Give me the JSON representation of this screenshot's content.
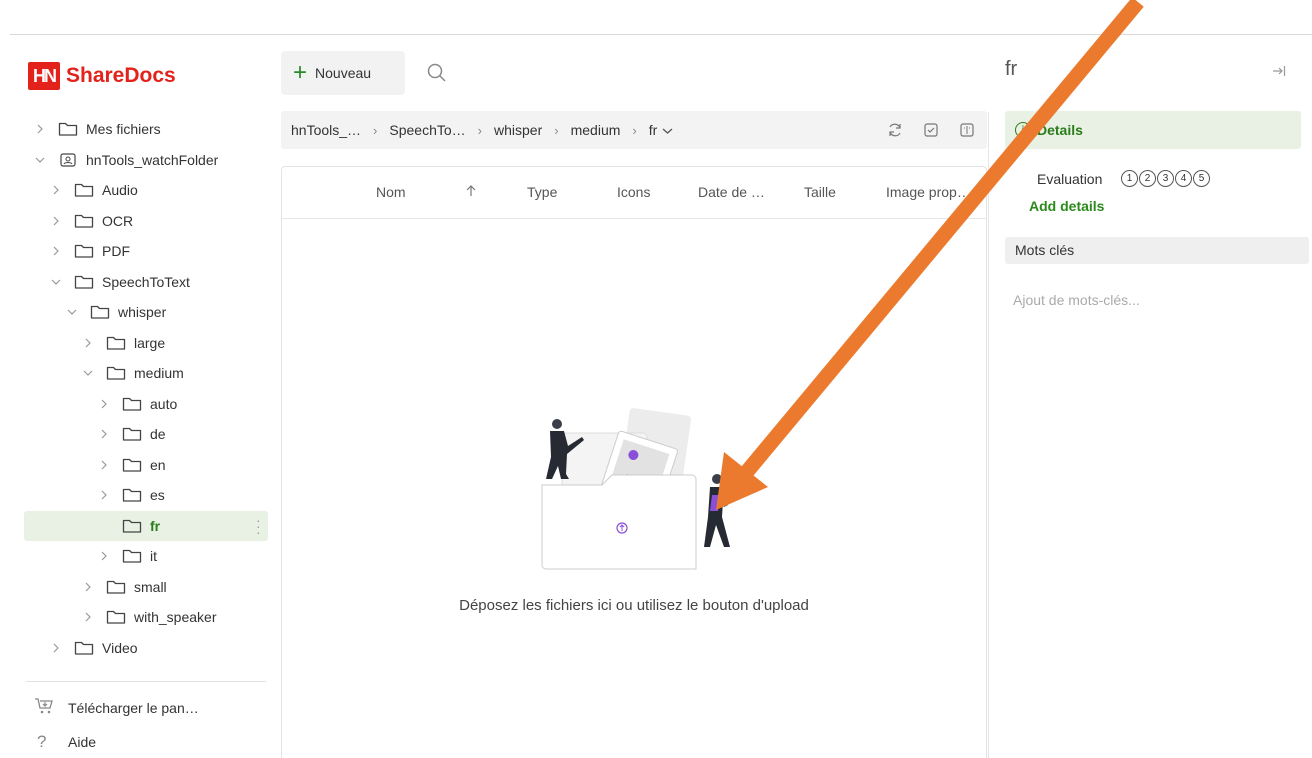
{
  "app": {
    "logo_mark": "HN",
    "logo_text": "ShareDocs"
  },
  "toolbar": {
    "new_label": "Nouveau",
    "new_icon": "plus-icon",
    "search_icon": "search-icon"
  },
  "sidebar": {
    "items": [
      {
        "label": "Mes fichiers",
        "depth": 0,
        "expanded": false,
        "icon": "folder-icon"
      },
      {
        "label": "hnTools_watchFolder",
        "depth": 0,
        "expanded": true,
        "icon": "shared-folder-icon"
      },
      {
        "label": "Audio",
        "depth": 1,
        "expanded": false,
        "icon": "folder-icon"
      },
      {
        "label": "OCR",
        "depth": 1,
        "expanded": false,
        "icon": "folder-icon"
      },
      {
        "label": "PDF",
        "depth": 1,
        "expanded": false,
        "icon": "folder-icon"
      },
      {
        "label": "SpeechToText",
        "depth": 1,
        "expanded": true,
        "icon": "folder-icon"
      },
      {
        "label": "whisper",
        "depth": 2,
        "expanded": true,
        "icon": "folder-icon"
      },
      {
        "label": "large",
        "depth": 3,
        "expanded": false,
        "icon": "folder-icon"
      },
      {
        "label": "medium",
        "depth": 3,
        "expanded": true,
        "icon": "folder-icon"
      },
      {
        "label": "auto",
        "depth": 4,
        "expanded": false,
        "icon": "folder-icon"
      },
      {
        "label": "de",
        "depth": 4,
        "expanded": false,
        "icon": "folder-icon"
      },
      {
        "label": "en",
        "depth": 4,
        "expanded": false,
        "icon": "folder-icon"
      },
      {
        "label": "es",
        "depth": 4,
        "expanded": false,
        "icon": "folder-icon"
      },
      {
        "label": "fr",
        "depth": 4,
        "expanded": null,
        "icon": "folder-icon",
        "selected": true
      },
      {
        "label": "it",
        "depth": 4,
        "expanded": false,
        "icon": "folder-icon"
      },
      {
        "label": "small",
        "depth": 3,
        "expanded": false,
        "icon": "folder-icon"
      },
      {
        "label": "with_speaker",
        "depth": 3,
        "expanded": false,
        "icon": "folder-icon"
      },
      {
        "label": "Video",
        "depth": 1,
        "expanded": false,
        "icon": "folder-icon"
      }
    ],
    "download_label": "Télécharger le pan…",
    "help_label": "Aide"
  },
  "breadcrumb": {
    "items": [
      "hnTools_…",
      "SpeechTo…",
      "whisper",
      "medium",
      "fr"
    ],
    "tools": [
      "refresh-icon",
      "select-all-icon",
      "columns-icon"
    ]
  },
  "filelist": {
    "columns": [
      "Nom",
      "Type",
      "Icons",
      "Date de …",
      "Taille",
      "Image prop…"
    ],
    "sort_icon": "arrow-up-icon",
    "empty_message": "Déposez les fichiers ici ou utilisez le bouton d'upload"
  },
  "details": {
    "title": "fr",
    "tab_label": "Details",
    "evaluation_label": "Evaluation",
    "rating_options": [
      "1",
      "2",
      "3",
      "4",
      "5"
    ],
    "add_details": "Add details",
    "keywords_label": "Mots clés",
    "keywords_placeholder": "Ajout de mots-clés..."
  },
  "colors": {
    "brand": "#e3231b",
    "accent_green": "#2a7d1a",
    "selected_bg": "#e9f1e4",
    "annotation_arrow": "#ec7a2e"
  }
}
